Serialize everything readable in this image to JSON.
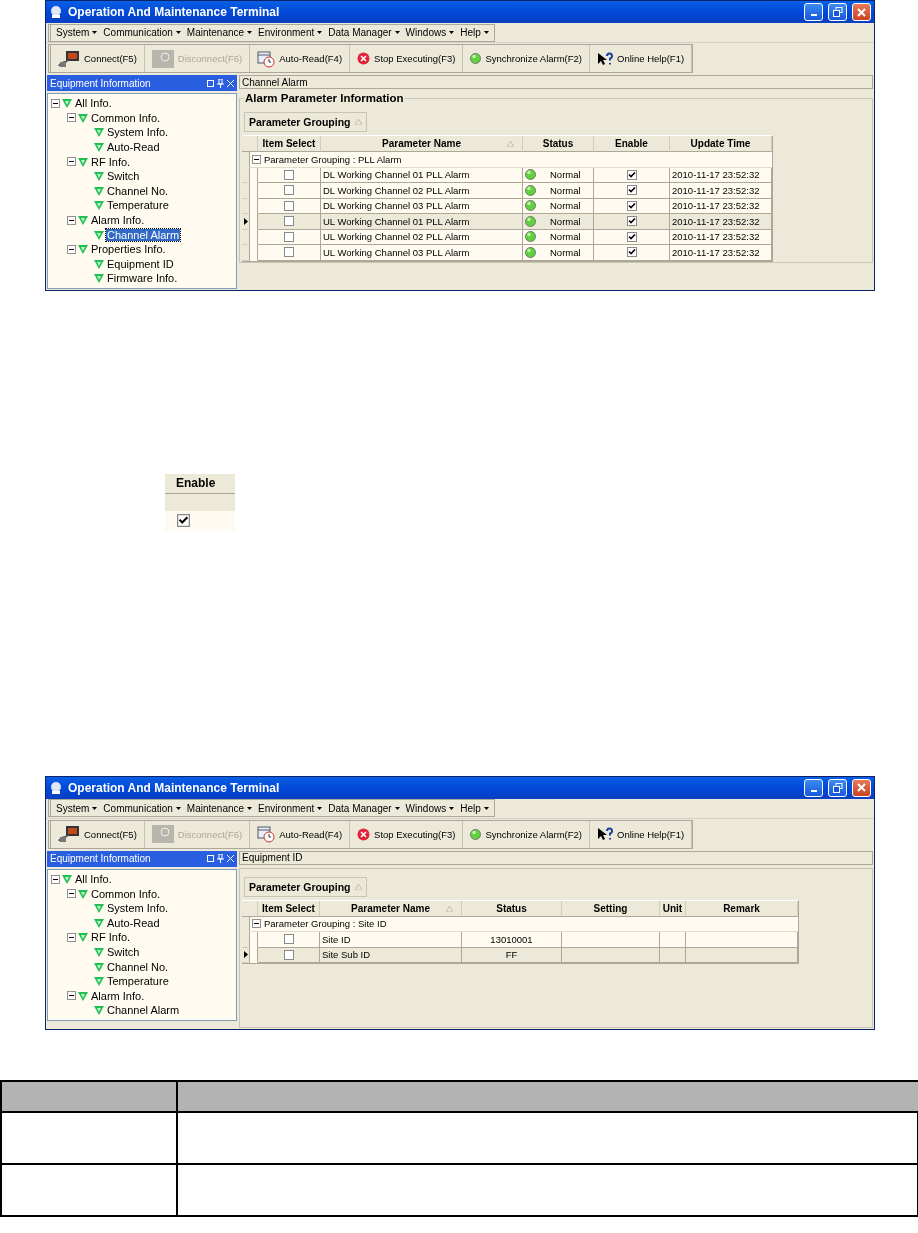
{
  "screens": [
    {
      "title": "Operation And Maintenance Terminal",
      "menu": [
        "System",
        "Communication",
        "Maintenance",
        "Environment",
        "Data Manager",
        "Windows",
        "Help"
      ],
      "toolbar": [
        {
          "kind": "connect",
          "label": "Connect(F5)",
          "disabled": false
        },
        {
          "kind": "disconnect",
          "label": "Disconnect(F6)",
          "disabled": true
        },
        {
          "kind": "autoread",
          "label": "Auto-Read(F4)",
          "disabled": false
        },
        {
          "kind": "stop",
          "label": "Stop Executing(F3)",
          "disabled": false
        },
        {
          "kind": "sync",
          "label": "Synchronize Alarm(F2)",
          "disabled": false
        },
        {
          "kind": "help",
          "label": "Online Help(F1)",
          "disabled": false
        }
      ],
      "panel_title": "Equipment Information",
      "tree": [
        {
          "label": "All Info.",
          "selected": false,
          "expanded": true,
          "children": [
            {
              "label": "Common Info.",
              "selected": false,
              "expanded": true,
              "children": [
                {
                  "label": "System Info.",
                  "selected": false
                },
                {
                  "label": "Auto-Read",
                  "selected": false
                }
              ]
            },
            {
              "label": "RF Info.",
              "selected": false,
              "expanded": true,
              "children": [
                {
                  "label": "Switch",
                  "selected": false
                },
                {
                  "label": "Channel No.",
                  "selected": false
                },
                {
                  "label": "Temperature",
                  "selected": false
                }
              ]
            },
            {
              "label": "Alarm Info.",
              "selected": false,
              "expanded": true,
              "children": [
                {
                  "label": "Channel Alarm",
                  "selected": true
                }
              ]
            },
            {
              "label": "Properties Info.",
              "selected": false,
              "expanded": true,
              "children": [
                {
                  "label": "Equipment ID",
                  "selected": false
                },
                {
                  "label": "Firmware Info.",
                  "selected": false
                }
              ]
            }
          ]
        }
      ],
      "tab_title": "Channel Alarm",
      "group_title": "Alarm Parameter Information",
      "group_button": {
        "label": "Parameter Grouping",
        "sorted": true
      },
      "table": {
        "columns": [
          {
            "label": "Item Select",
            "sorted": false
          },
          {
            "label": "Parameter Name",
            "sorted": true
          },
          {
            "label": "Status",
            "sorted": false
          },
          {
            "label": "Enable",
            "sorted": false
          },
          {
            "label": "Update Time",
            "sorted": false
          }
        ],
        "group_row": {
          "label": "Parameter Grouping : PLL Alarm",
          "expanded": true
        },
        "rows": [
          {
            "selected": false,
            "cells": [
              {
                "kind": "check",
                "checked": false
              },
              {
                "kind": "text",
                "text": "DL Working Channel 01 PLL Alarm"
              },
              {
                "kind": "status",
                "text": "Normal"
              },
              {
                "kind": "check",
                "checked": true
              },
              {
                "kind": "text",
                "text": "2010-11-17 23:52:32"
              }
            ]
          },
          {
            "selected": false,
            "cells": [
              {
                "kind": "check",
                "checked": false
              },
              {
                "kind": "text",
                "text": "DL Working Channel 02 PLL Alarm"
              },
              {
                "kind": "status",
                "text": "Normal"
              },
              {
                "kind": "check",
                "checked": true
              },
              {
                "kind": "text",
                "text": "2010-11-17 23:52:32"
              }
            ]
          },
          {
            "selected": false,
            "cells": [
              {
                "kind": "check",
                "checked": false
              },
              {
                "kind": "text",
                "text": "DL Working Channel 03 PLL Alarm"
              },
              {
                "kind": "status",
                "text": "Normal"
              },
              {
                "kind": "check",
                "checked": true
              },
              {
                "kind": "text",
                "text": "2010-11-17 23:52:32"
              }
            ]
          },
          {
            "selected": true,
            "cells": [
              {
                "kind": "check",
                "checked": false
              },
              {
                "kind": "text",
                "text": "UL Working Channel 01 PLL Alarm"
              },
              {
                "kind": "status",
                "text": "Normal"
              },
              {
                "kind": "check",
                "checked": true
              },
              {
                "kind": "text",
                "text": "2010-11-17 23:52:32"
              }
            ]
          },
          {
            "selected": false,
            "cells": [
              {
                "kind": "check",
                "checked": false
              },
              {
                "kind": "text",
                "text": "UL Working Channel 02 PLL Alarm"
              },
              {
                "kind": "status",
                "text": "Normal"
              },
              {
                "kind": "check",
                "checked": true
              },
              {
                "kind": "text",
                "text": "2010-11-17 23:52:32"
              }
            ]
          },
          {
            "selected": false,
            "cells": [
              {
                "kind": "check",
                "checked": false
              },
              {
                "kind": "text",
                "text": "UL Working Channel 03 PLL Alarm"
              },
              {
                "kind": "status",
                "text": "Normal"
              },
              {
                "kind": "check",
                "checked": true
              },
              {
                "kind": "text",
                "text": "2010-11-17 23:52:32"
              }
            ]
          }
        ]
      }
    },
    {
      "title": "Operation And Maintenance Terminal",
      "menu": [
        "System",
        "Communication",
        "Maintenance",
        "Environment",
        "Data Manager",
        "Windows",
        "Help"
      ],
      "toolbar": [
        {
          "kind": "connect",
          "label": "Connect(F5)",
          "disabled": false
        },
        {
          "kind": "disconnect",
          "label": "Disconnect(F6)",
          "disabled": true
        },
        {
          "kind": "autoread",
          "label": "Auto-Read(F4)",
          "disabled": false
        },
        {
          "kind": "stop",
          "label": "Stop Executing(F3)",
          "disabled": false
        },
        {
          "kind": "sync",
          "label": "Synchronize Alarm(F2)",
          "disabled": false
        },
        {
          "kind": "help",
          "label": "Online Help(F1)",
          "disabled": false
        }
      ],
      "panel_title": "Equipment Information",
      "tree": [
        {
          "label": "All Info.",
          "selected": false,
          "expanded": true,
          "children": [
            {
              "label": "Common Info.",
              "selected": false,
              "expanded": true,
              "children": [
                {
                  "label": "System Info.",
                  "selected": false
                },
                {
                  "label": "Auto-Read",
                  "selected": false
                }
              ]
            },
            {
              "label": "RF Info.",
              "selected": false,
              "expanded": true,
              "children": [
                {
                  "label": "Switch",
                  "selected": false
                },
                {
                  "label": "Channel No.",
                  "selected": false
                },
                {
                  "label": "Temperature",
                  "selected": false
                }
              ]
            },
            {
              "label": "Alarm Info.",
              "selected": false,
              "expanded": true,
              "children": [
                {
                  "label": "Channel Alarm",
                  "selected": false
                }
              ]
            }
          ]
        }
      ],
      "tab_title": "Equipment ID",
      "group_button": {
        "label": "Parameter Grouping",
        "sorted": true
      },
      "table": {
        "columns": [
          {
            "label": "Item Select",
            "sorted": false
          },
          {
            "label": "Parameter Name",
            "sorted": true
          },
          {
            "label": "Status",
            "sorted": false
          },
          {
            "label": "Setting",
            "sorted": false
          },
          {
            "label": "Unit",
            "sorted": false
          },
          {
            "label": "Remark",
            "sorted": false
          }
        ],
        "group_row": {
          "label": "Parameter Grouping : Site ID",
          "expanded": true
        },
        "rows": [
          {
            "selected": false,
            "cells": [
              {
                "kind": "check",
                "checked": false
              },
              {
                "kind": "text",
                "text": "Site ID"
              },
              {
                "kind": "center",
                "text": "13010001"
              },
              {
                "kind": "blank"
              },
              {
                "kind": "blank"
              },
              {
                "kind": "blank"
              }
            ]
          },
          {
            "selected": true,
            "cells": [
              {
                "kind": "check",
                "checked": false
              },
              {
                "kind": "text",
                "text": "Site Sub ID"
              },
              {
                "kind": "center",
                "text": "FF"
              },
              {
                "kind": "blank"
              },
              {
                "kind": "blank"
              },
              {
                "kind": "blank"
              }
            ]
          }
        ]
      }
    }
  ],
  "enable_closeup": {
    "header": "Enable",
    "checked": true
  }
}
